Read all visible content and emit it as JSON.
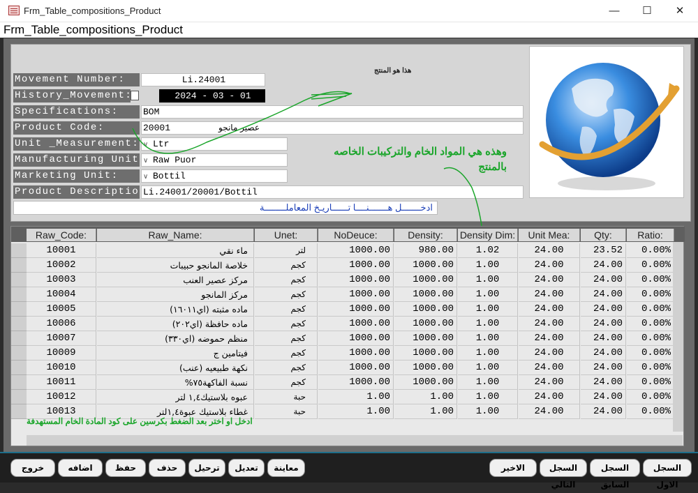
{
  "window": {
    "title": "Frm_Table_compositions_Product",
    "minimize": "—",
    "maximize": "☐",
    "close": "✕"
  },
  "form_title": "Frm_Table_compositions_Product",
  "fields": [
    {
      "label": "Movement Number:",
      "value": "Li.24001"
    },
    {
      "label": "History_Movement:",
      "value": "2024 - 03 - 01"
    },
    {
      "label": "Specifications:",
      "value": "BOM"
    },
    {
      "label": "Product Code:",
      "value": "20001",
      "extra": "عصير مانجو"
    },
    {
      "label": "Unit _Measurement:",
      "value": "Ltr"
    },
    {
      "label": "Manufacturing Unit:",
      "value": "Raw Puor"
    },
    {
      "label": "Marketing Unit:",
      "value": "Bottil"
    },
    {
      "label": "Product Description:",
      "value": "Li.24001/20001/Bottil"
    }
  ],
  "hint": "ادخـــــــل هـــــــنــــا تــــــاريـخ المعاملــــــــة",
  "note_top": "هذا هو المنتج",
  "note_green": "وهذه هي المواد الخام والتركيبات الخاصه بالمنتج",
  "grid": {
    "columns": [
      "Raw_Code:",
      "Raw_Name:",
      "Unet:",
      "NoDeuce:",
      "Density:",
      "Density Dim:",
      "Unit Mea:",
      "Qty:",
      "Ratio:"
    ],
    "rows": [
      [
        "10001",
        "ماء نقي",
        "لتر",
        "1000.00",
        "980.00",
        "1.02",
        "24.00",
        "23.52",
        "0.00%"
      ],
      [
        "10002",
        "خلاصة المانجو حبيبات",
        "كجم",
        "1000.00",
        "1000.00",
        "1.00",
        "24.00",
        "24.00",
        "0.00%"
      ],
      [
        "10003",
        "مركز عصير العنب",
        "كجم",
        "1000.00",
        "1000.00",
        "1.00",
        "24.00",
        "24.00",
        "0.00%"
      ],
      [
        "10004",
        "مركز المانجو",
        "كجم",
        "1000.00",
        "1000.00",
        "1.00",
        "24.00",
        "24.00",
        "0.00%"
      ],
      [
        "10005",
        "ماده مثبته (اي١٦٠١١)",
        "كجم",
        "1000.00",
        "1000.00",
        "1.00",
        "24.00",
        "24.00",
        "0.00%"
      ],
      [
        "10006",
        "ماده حافظة (اي٢٠٢)",
        "كجم",
        "1000.00",
        "1000.00",
        "1.00",
        "24.00",
        "24.00",
        "0.00%"
      ],
      [
        "10007",
        "منظم حموضه (اي٣٣٠)",
        "كجم",
        "1000.00",
        "1000.00",
        "1.00",
        "24.00",
        "24.00",
        "0.00%"
      ],
      [
        "10009",
        "فيتامين ج",
        "كجم",
        "1000.00",
        "1000.00",
        "1.00",
        "24.00",
        "24.00",
        "0.00%"
      ],
      [
        "10010",
        "نكهة طبيعيه (عنب)",
        "كجم",
        "1000.00",
        "1000.00",
        "1.00",
        "24.00",
        "24.00",
        "0.00%"
      ],
      [
        "10011",
        "نسبة الفاكهة٧٥%",
        "كجم",
        "1000.00",
        "1000.00",
        "1.00",
        "24.00",
        "24.00",
        "0.00%"
      ],
      [
        "10012",
        "عبوه بلاستيك١,٤ لتر",
        "حبة",
        "1.00",
        "1.00",
        "1.00",
        "24.00",
        "24.00",
        "0.00%"
      ],
      [
        "10013",
        "غطاء بلاستيك عبوة١,٤لتر",
        "حبة",
        "1.00",
        "1.00",
        "1.00",
        "24.00",
        "24.00",
        "0.00%"
      ]
    ],
    "footer_note": "ادخل او اختر بعد الضغط بكرسين على كود المادة الخام المستهدفة"
  },
  "buttons_right": [
    "السجل الاول",
    "السجل السابق",
    "السجل التالي",
    "الاخير"
  ],
  "buttons_left": [
    "معاينة",
    "تعديل",
    "ترحيل",
    "حذف",
    "حفظ",
    "اضافه",
    "خروج"
  ],
  "colors": {
    "green_annotation": "#1aa52a",
    "hint_blue": "#1b3fb8",
    "label_bg": "#6e6e6e"
  }
}
